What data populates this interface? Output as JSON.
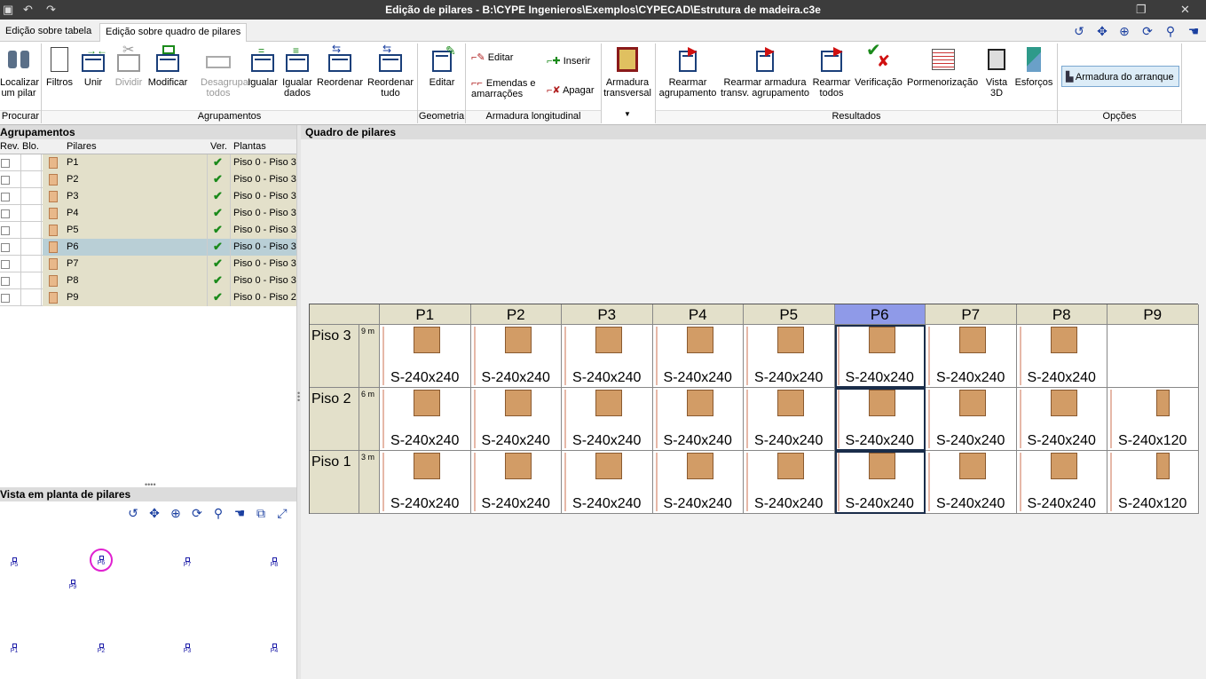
{
  "titlebar": {
    "title": "Edição de pilares - B:\\CYPE Ingenieros\\Exemplos\\CYPECAD\\Estrutura de madeira.c3e"
  },
  "tabs": [
    {
      "label": "Edição sobre tabela"
    },
    {
      "label": "Edição sobre quadro de pilares"
    }
  ],
  "ribbon": {
    "localizar": "Localizar um pilar",
    "filtros": "Filtros",
    "unir": "Unir",
    "dividir": "Dividir",
    "modificar": "Modificar",
    "desagrupar": "Desagrupar todos",
    "igualar": "Igualar",
    "igualar_dados": "Igualar dados",
    "reordenar": "Reordenar",
    "reordenar_tudo": "Reordenar tudo",
    "geo_editar": "Editar",
    "al_editar": "Editar",
    "al_inserir": "Inserir",
    "al_emendas": "Emendas e amarrações",
    "al_apagar": "Apagar",
    "armadura_transversal": "Armadura transversal",
    "rearmar_agrupamento": "Rearmar agrupamento",
    "rearmar_transv": "Rearmar armadura transv. agrupamento",
    "rearmar_todos": "Rearmar todos",
    "verificacao": "Verificação",
    "pormenorizacao": "Pormenorização",
    "vista3d": "Vista 3D",
    "esforcos": "Esforços",
    "armadura_arranque": "Armadura do arranque",
    "groups": {
      "procurar": "Procurar",
      "agrupamentos": "Agrupamentos",
      "geometria": "Geometria",
      "armadura_longitudinal": "Armadura longitudinal",
      "resultados": "Resultados",
      "opcoes": "Opções"
    }
  },
  "left": {
    "header": "Agrupamentos",
    "cols": {
      "rev": "Rev.",
      "blo": "Blo.",
      "pilares": "Pilares",
      "ver": "Ver.",
      "plantas": "Plantas"
    },
    "rows": [
      {
        "name": "P1",
        "plantas": "Piso 0 - Piso 3"
      },
      {
        "name": "P2",
        "plantas": "Piso 0 - Piso 3"
      },
      {
        "name": "P3",
        "plantas": "Piso 0 - Piso 3"
      },
      {
        "name": "P4",
        "plantas": "Piso 0 - Piso 3"
      },
      {
        "name": "P5",
        "plantas": "Piso 0 - Piso 3"
      },
      {
        "name": "P6",
        "plantas": "Piso 0 - Piso 3"
      },
      {
        "name": "P7",
        "plantas": "Piso 0 - Piso 3"
      },
      {
        "name": "P8",
        "plantas": "Piso 0 - Piso 3"
      },
      {
        "name": "P9",
        "plantas": "Piso 0 - Piso 2"
      }
    ],
    "check": "✔",
    "plan_header": "Vista em planta de pilares",
    "plan_labels": {
      "P5": "P5",
      "P6": "P6",
      "P7": "P7",
      "P8": "P8",
      "P9": "P9",
      "P1": "P1",
      "P2": "P2",
      "P3": "P3",
      "P4": "P4"
    }
  },
  "right": {
    "header": "Quadro de pilares",
    "columns": [
      "P1",
      "P2",
      "P3",
      "P4",
      "P5",
      "P6",
      "P7",
      "P8",
      "P9"
    ],
    "floors": [
      {
        "name": "Piso 3",
        "h": "9 m",
        "cells": [
          "S-240x240",
          "S-240x240",
          "S-240x240",
          "S-240x240",
          "S-240x240",
          "S-240x240",
          "S-240x240",
          "S-240x240",
          ""
        ]
      },
      {
        "name": "Piso 2",
        "h": "6 m",
        "cells": [
          "S-240x240",
          "S-240x240",
          "S-240x240",
          "S-240x240",
          "S-240x240",
          "S-240x240",
          "S-240x240",
          "S-240x240",
          "S-240x120"
        ]
      },
      {
        "name": "Piso 1",
        "h": "3 m",
        "cells": [
          "S-240x240",
          "S-240x240",
          "S-240x240",
          "S-240x240",
          "S-240x240",
          "S-240x240",
          "S-240x240",
          "S-240x240",
          "S-240x120"
        ]
      }
    ],
    "selected_column": "P6"
  }
}
